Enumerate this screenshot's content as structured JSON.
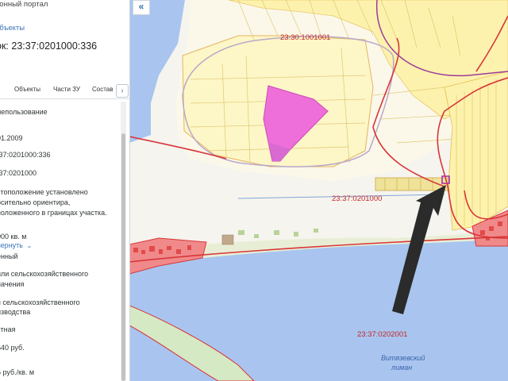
{
  "header": {
    "portal_title": "ионный портал",
    "objects_link": "объекты",
    "parcel_title": "ок: 23:37:0201000:336"
  },
  "tabs": [
    {
      "label": "Объекты"
    },
    {
      "label": "Части ЗУ"
    },
    {
      "label": "Состав"
    }
  ],
  "tabs_next_icon": "chevron-right-icon",
  "collapse_icon": "double-chevron-left-icon",
  "details": {
    "use_type": "лепользование",
    "date": "01.2009",
    "cad_number": ":37:0201000:336",
    "quarter": ":37:0201000",
    "address_line1": "стоположение установлено",
    "address_line2": "осительно ориентира,",
    "address_line3": "положенного в границах участка.",
    "area": "000 кв. м",
    "collapse_link": "вернуть",
    "status": "енный",
    "category_line1": "или сельскохозяйственного",
    "category_line2": "начения",
    "use_line1": "я сельскохозяйственного",
    "use_line2": "изводства",
    "ownership": "стная",
    "cad_value": " 640 руб.",
    "cad_value_per_m": "6 руб./кв. м"
  },
  "map": {
    "labels": {
      "quarter_north": "23:30:1001001",
      "quarter_center": "23:37:0201000",
      "quarter_south": "23:37:0202001",
      "lake_line1": "Витязевский",
      "lake_line2": "лиман"
    },
    "colors": {
      "water": "#a9c5ef",
      "parcel_fill": "#fdf2ad",
      "border_red": "#d8363a",
      "pink_parcel": "#ee6fd9",
      "link_blue": "#3a73b8"
    }
  }
}
